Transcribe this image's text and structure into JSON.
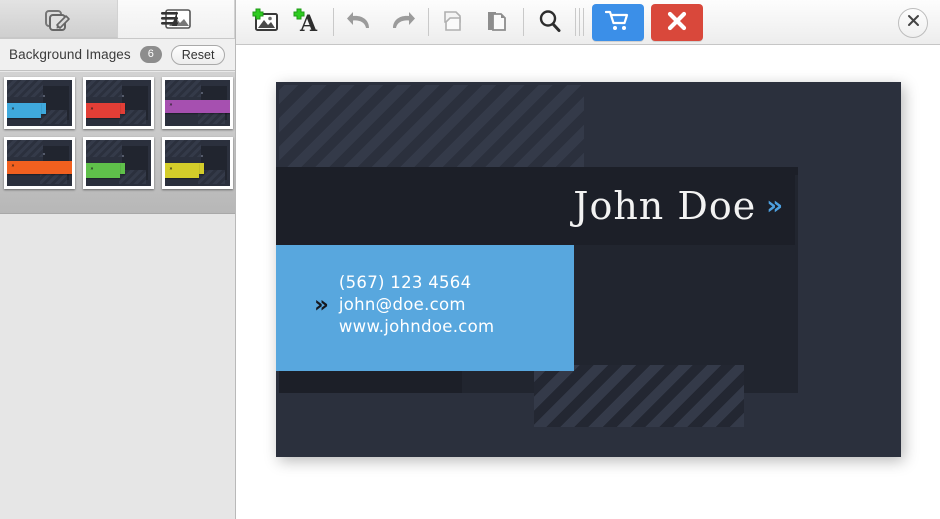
{
  "left_panel": {
    "tabs": [
      {
        "id": "design-tab",
        "icon": "edit-pencil-icon",
        "active": true
      },
      {
        "id": "background-images-tab",
        "icon": "background-images-icon",
        "active": false
      }
    ],
    "header": {
      "title": "Background Images",
      "count": "6",
      "reset_label": "Reset"
    },
    "thumbnails": [
      {
        "name": "thumb-blue",
        "color": "#3fa9dd",
        "layout": "left"
      },
      {
        "name": "thumb-red",
        "color": "#e23e36",
        "layout": "left"
      },
      {
        "name": "thumb-purple",
        "color": "#a650b0",
        "layout": "full"
      },
      {
        "name": "thumb-orange",
        "color": "#f1601f",
        "layout": "full"
      },
      {
        "name": "thumb-green",
        "color": "#5fc04a",
        "layout": "left"
      },
      {
        "name": "thumb-yellow",
        "color": "#d4cd2a",
        "layout": "left"
      }
    ]
  },
  "toolbar": {
    "buttons": [
      {
        "name": "add-image-button",
        "icon": "add-image-icon"
      },
      {
        "name": "add-text-button",
        "icon": "add-text-icon"
      },
      {
        "name": "undo-button",
        "icon": "undo-arrow-icon"
      },
      {
        "name": "redo-button",
        "icon": "redo-arrow-icon"
      },
      {
        "name": "copy-button",
        "icon": "copy-icon"
      },
      {
        "name": "paste-button",
        "icon": "paste-icon"
      },
      {
        "name": "zoom-button",
        "icon": "magnifier-icon"
      },
      {
        "name": "cart-button",
        "icon": "shopping-cart-icon"
      },
      {
        "name": "delete-button",
        "icon": "red-x-icon"
      }
    ],
    "cart_color": "#3b8fe8",
    "delete_color": "#d9483b",
    "close_icon": "close-x-icon"
  },
  "card": {
    "name": "John Doe",
    "name_chevron": "»",
    "contact_chevron": "»",
    "contact": {
      "phone": "(567) 123 4564",
      "email": "john@doe.com",
      "website": "www.johndoe.com"
    },
    "colors": {
      "background": "#2b303d",
      "panel_dark": "#1c1f28",
      "accent_blue": "#58a7de",
      "name_chevron_blue": "#4da0e0"
    }
  }
}
